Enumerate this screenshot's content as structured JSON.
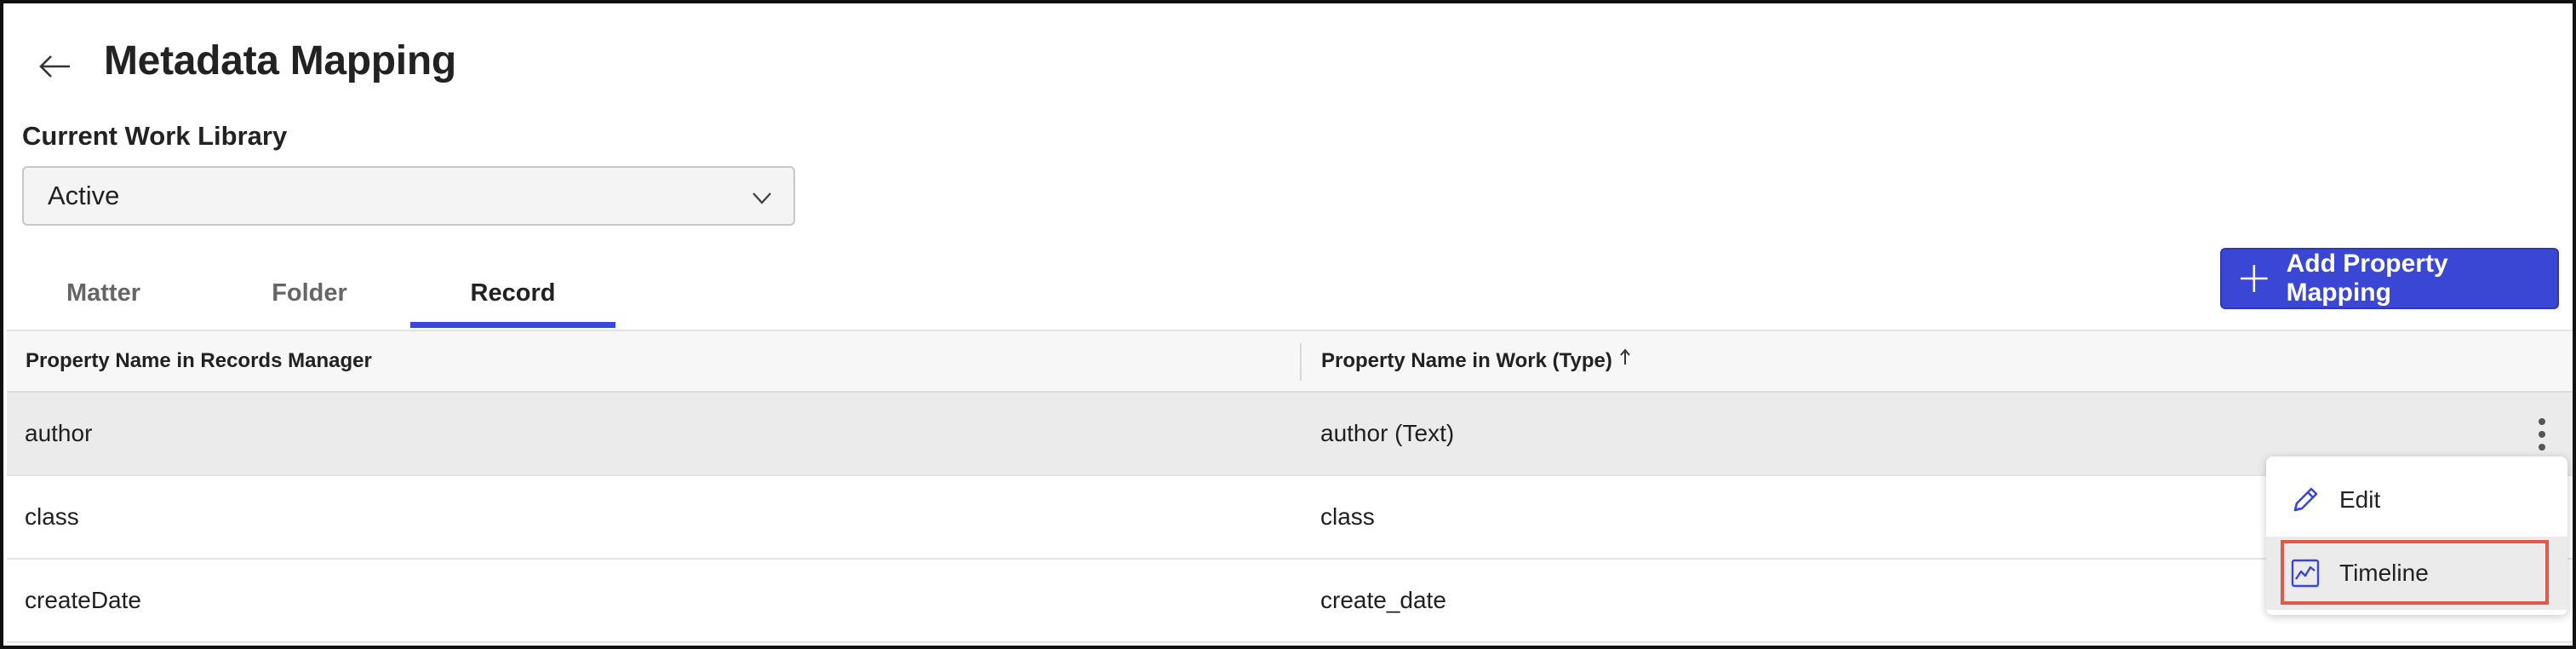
{
  "header": {
    "back_icon": "arrow-left-icon",
    "title": "Metadata Mapping"
  },
  "library": {
    "label": "Current Work Library",
    "selected": "Active",
    "chevron_icon": "chevron-down-icon"
  },
  "tabs": [
    {
      "label": "Matter",
      "active": false
    },
    {
      "label": "Folder",
      "active": false
    },
    {
      "label": "Record",
      "active": true
    }
  ],
  "toolbar": {
    "add_label": "Add Property Mapping",
    "add_icon": "plus-icon"
  },
  "table": {
    "columns": [
      {
        "label": "Property Name in Records Manager"
      },
      {
        "label": "Property Name in Work (Type)",
        "sort_icon": "sort-ascending-icon"
      }
    ],
    "rows": [
      {
        "rm": "author",
        "work": "author (Text)"
      },
      {
        "rm": "class",
        "work": "class"
      },
      {
        "rm": "createDate",
        "work": "create_date"
      }
    ]
  },
  "context_menu": {
    "items": [
      {
        "label": "Edit",
        "icon": "pencil-icon"
      },
      {
        "label": "Timeline",
        "icon": "timeline-chart-icon"
      }
    ],
    "highlighted_item": "Timeline"
  },
  "colors": {
    "accent": "#3A46D4",
    "highlight_border": "#E05A4A",
    "hover_row": "#EBEBEC"
  }
}
